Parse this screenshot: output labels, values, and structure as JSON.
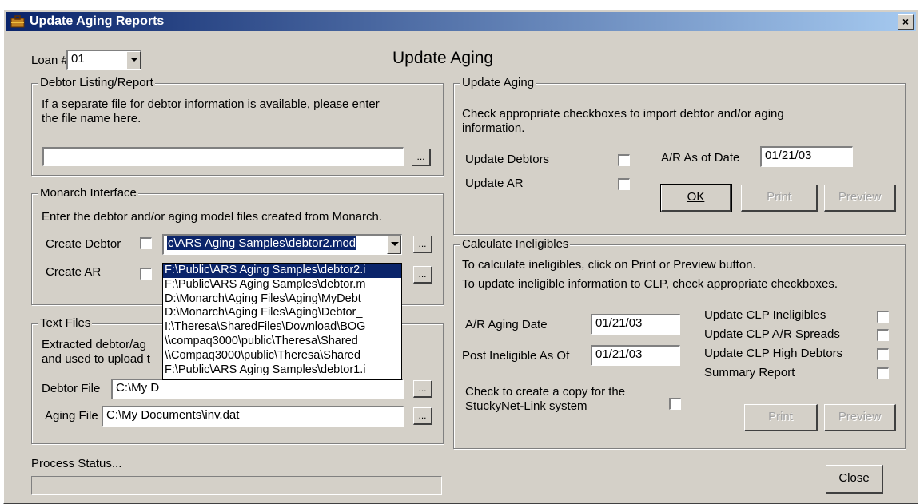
{
  "window": {
    "title": "Update Aging Reports",
    "close": "×"
  },
  "header": {
    "loan_label": "Loan #",
    "loan_value": "01",
    "heading": "Update Aging"
  },
  "debtor_listing": {
    "title": "Debtor Listing/Report",
    "desc_line1": "If a separate file for debtor information is available, please enter",
    "desc_line2": "the file name here.",
    "file_value": "",
    "browse": "..."
  },
  "monarch": {
    "title": "Monarch Interface",
    "desc": "Enter the debtor and/or aging model files created from Monarch.",
    "create_debtor_label": "Create Debtor",
    "create_ar_label": "Create AR",
    "debtor_model_value": "c\\ARS Aging Samples\\debtor2.mod",
    "browse": "...",
    "dropdown_items": [
      "F:\\Public\\ARS Aging Samples\\debtor2.i",
      "F:\\Public\\ARS Aging Samples\\debtor.m",
      "D:\\Monarch\\Aging Files\\Aging\\MyDebt",
      "D:\\Monarch\\Aging Files\\Aging\\Debtor_",
      "I:\\Theresa\\SharedFiles\\Download\\BOG",
      "\\\\compaq3000\\public\\Theresa\\Shared",
      "\\\\Compaq3000\\public\\Theresa\\Shared",
      "F:\\Public\\ARS Aging Samples\\debtor1.i"
    ]
  },
  "text_files": {
    "title": "Text Files",
    "desc_line1": "Extracted debtor/ag",
    "desc_line2": "and used to upload t",
    "debtor_file_label": "Debtor File",
    "debtor_file_value": "C:\\My D",
    "aging_file_label": "Aging File",
    "aging_file_value": "C:\\My Documents\\inv.dat",
    "browse": "..."
  },
  "update_aging": {
    "title": "Update Aging",
    "desc_line1": "Check appropriate checkboxes to import debtor and/or aging",
    "desc_line2": "information.",
    "update_debtors_label": "Update Debtors",
    "update_ar_label": "Update AR",
    "ar_as_of_label": "A/R As of Date",
    "ar_as_of_value": "01/21/03",
    "ok": "OK",
    "print": "Print",
    "preview": "Preview"
  },
  "calc_ineligibles": {
    "title": "Calculate Ineligibles",
    "desc_line1": "To calculate ineligibles, click on Print or Preview button.",
    "desc_line2": "To update ineligible information to CLP, check appropriate checkboxes.",
    "ar_aging_date_label": "A/R Aging Date",
    "ar_aging_date_value": "01/21/03",
    "post_ineligible_label": "Post Ineligible As Of",
    "post_ineligible_value": "01/21/03",
    "update_clp_ineligibles": "Update CLP Ineligibles",
    "update_clp_ar_spreads": "Update CLP A/R Spreads",
    "update_clp_high_debtors": "Update CLP High Debtors",
    "summary_report": "Summary Report",
    "copy_line1": "Check to create a copy for the",
    "copy_line2": "StuckyNet-Link system",
    "print": "Print",
    "preview": "Preview"
  },
  "footer": {
    "process_status": "Process Status...",
    "close": "Close"
  }
}
